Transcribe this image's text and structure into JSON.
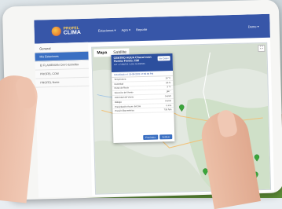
{
  "app": {
    "logo_line1": "PROFEL",
    "logo_line2": "CLIMA"
  },
  "navbar": {
    "items": [
      {
        "label": "Estaciones ▾"
      },
      {
        "label": "Agro ▾"
      },
      {
        "label": "Reporte"
      }
    ],
    "user": "Demo ▾"
  },
  "sidebar": {
    "heading": "General",
    "items": [
      {
        "label": "Mis Estaciones",
        "active": true
      },
      {
        "label": "El FLAMENIAN Cerro Estrellas",
        "active": false
      },
      {
        "label": "PROFEL COM",
        "active": false
      },
      {
        "label": "PROFEL Norte",
        "active": false
      }
    ]
  },
  "map": {
    "tabs": [
      {
        "label": "Mapa",
        "active": true
      },
      {
        "label": "Satélite",
        "active": false
      }
    ],
    "popup": {
      "title": "CENTRO AGUA Chacal roan Puesto Fondo, CMI",
      "subtitle": "LAT -17.984715 / LON -64.990535",
      "button": "Ver Datos",
      "date": "Actualizado el: 16-08-2021 17:55:00 PM",
      "rows": [
        {
          "label": "Temperatura",
          "value": "18 °C"
        },
        {
          "label": "Humedad",
          "value": "86 %"
        },
        {
          "label": "Punto de Rocío",
          "value": "3 °C"
        },
        {
          "label": "Dirección del Viento",
          "value": "180 °"
        },
        {
          "label": "Velocidad del Viento",
          "value": "0 km/h"
        },
        {
          "label": "Ráfaga",
          "value": "0 km/h"
        },
        {
          "label": "Precipitación Acum. del Día",
          "value": "0 mm"
        },
        {
          "label": "Presión Barométrica",
          "value": "733 hpa"
        }
      ],
      "footer_buttons": [
        "Pronóstico",
        "Gráficar"
      ]
    }
  },
  "colors": {
    "navbar": "#3756a8",
    "sidebar_active": "#3a6fc2",
    "popup_header": "#2c4f9e",
    "marker": "#3aa63a"
  }
}
